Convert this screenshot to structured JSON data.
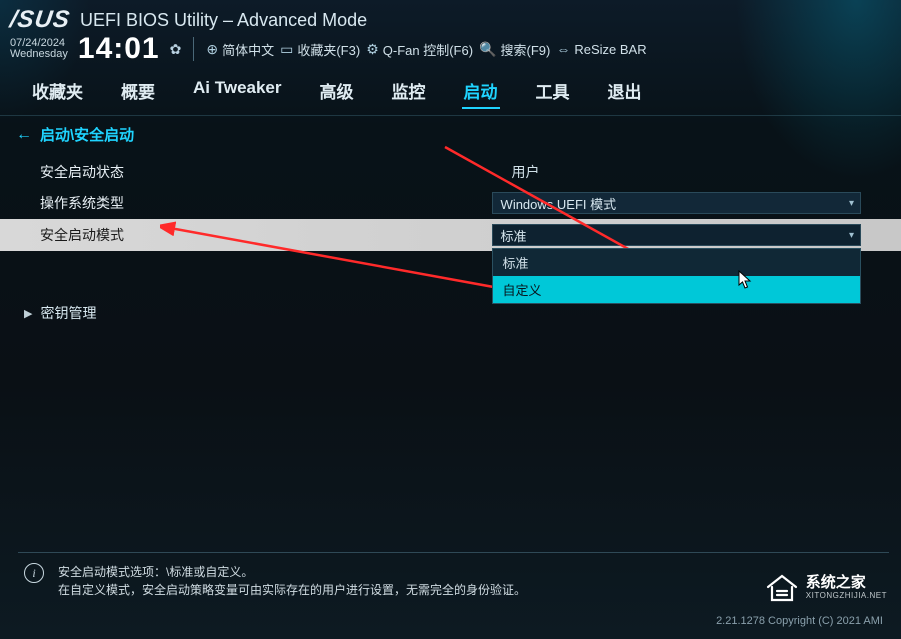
{
  "header": {
    "brand": "/SUS",
    "title": "UEFI BIOS Utility – Advanced Mode",
    "date": "07/24/2024",
    "weekday": "Wednesday",
    "time": "14:01"
  },
  "toolbar": {
    "language": "简体中文",
    "favorites": "收藏夹(F3)",
    "qfan": "Q-Fan 控制(F6)",
    "search": "搜索(F9)",
    "resize_bar": "ReSize BAR"
  },
  "tabs": [
    {
      "id": "fav",
      "label": "收藏夹"
    },
    {
      "id": "main",
      "label": "概要"
    },
    {
      "id": "ai",
      "label": "Ai Tweaker"
    },
    {
      "id": "adv",
      "label": "高级"
    },
    {
      "id": "monitor",
      "label": "监控"
    },
    {
      "id": "boot",
      "label": "启动",
      "active": true
    },
    {
      "id": "tool",
      "label": "工具"
    },
    {
      "id": "exit",
      "label": "退出"
    }
  ],
  "breadcrumb": "启动\\安全启动",
  "settings": {
    "secure_boot_state": {
      "label": "安全启动状态",
      "value": "用户"
    },
    "os_type": {
      "label": "操作系统类型",
      "value": "Windows UEFI 模式"
    },
    "secure_boot_mode": {
      "label": "安全启动模式",
      "selected": "标准",
      "options": [
        "标准",
        "自定义"
      ],
      "hover_index": 1
    },
    "key_mgmt": {
      "label": "密钥管理"
    }
  },
  "help": {
    "line1": "安全启动模式选项：\\标准或自定义。",
    "line2": "在自定义模式，安全启动策略变量可由实际存在的用户进行设置，无需完全的身份验证。"
  },
  "footer": {
    "copyright": "2.21.1278 Copyright (C) 2021 AMI"
  },
  "watermark": {
    "main": "系统之家",
    "sub": "XITONGZHIJIA.NET"
  }
}
